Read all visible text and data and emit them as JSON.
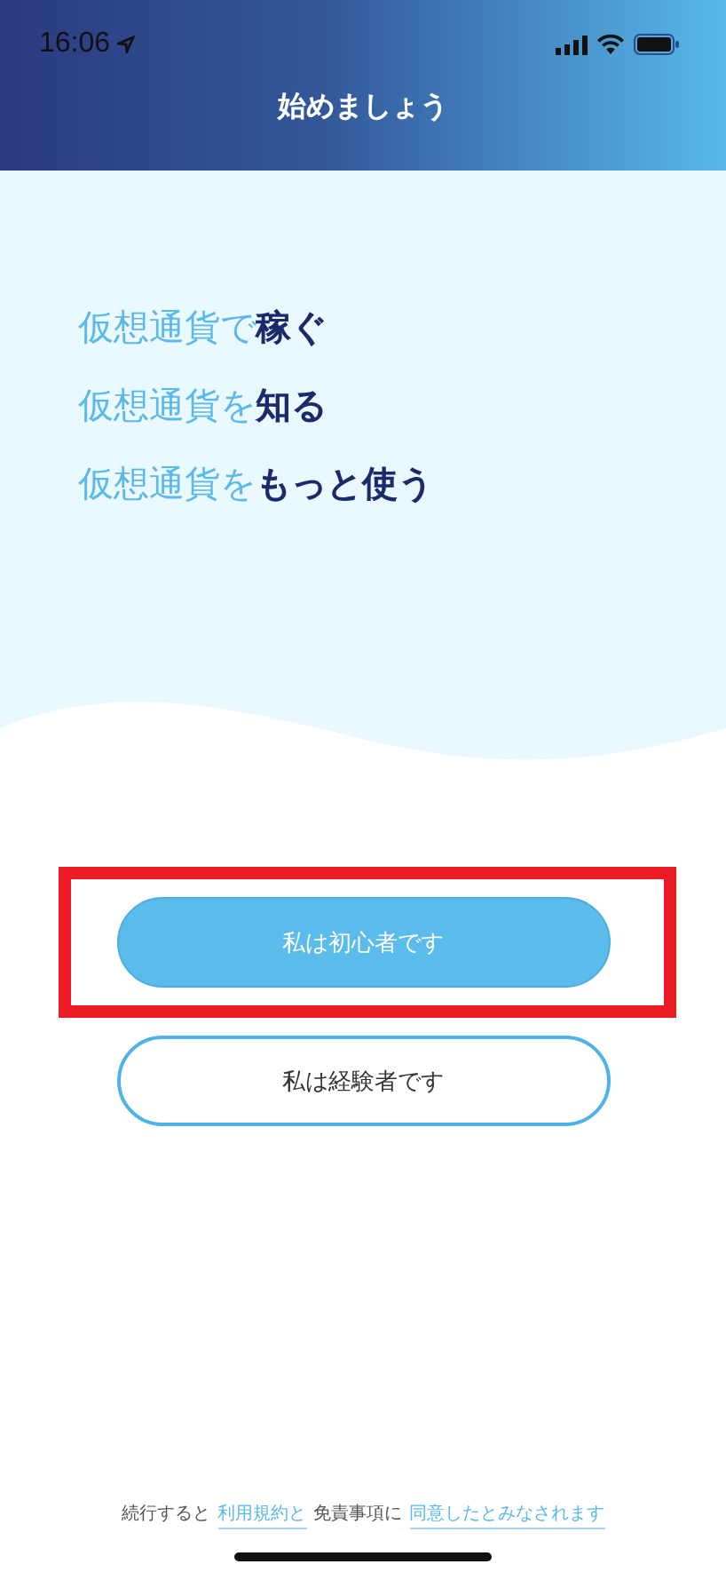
{
  "status_bar": {
    "time": "16:06"
  },
  "header": {
    "title": "始めましょう"
  },
  "headlines": [
    {
      "prefix": "仮想通貨で",
      "emphasis": "稼ぐ"
    },
    {
      "prefix": "仮想通貨を",
      "emphasis": "知る"
    },
    {
      "prefix": "仮想通貨を",
      "emphasis": "もっと使う"
    }
  ],
  "buttons": [
    {
      "label": "私は初心者です",
      "kind": "primary",
      "highlighted": true
    },
    {
      "label": "私は経験者です",
      "kind": "secondary",
      "highlighted": false
    }
  ],
  "footer": [
    {
      "text": "続行すると",
      "kind": "text"
    },
    {
      "text": "利用規約と",
      "kind": "link"
    },
    {
      "text": "免責事項に",
      "kind": "text"
    },
    {
      "text": "同意したとみなされます",
      "kind": "link"
    }
  ]
}
